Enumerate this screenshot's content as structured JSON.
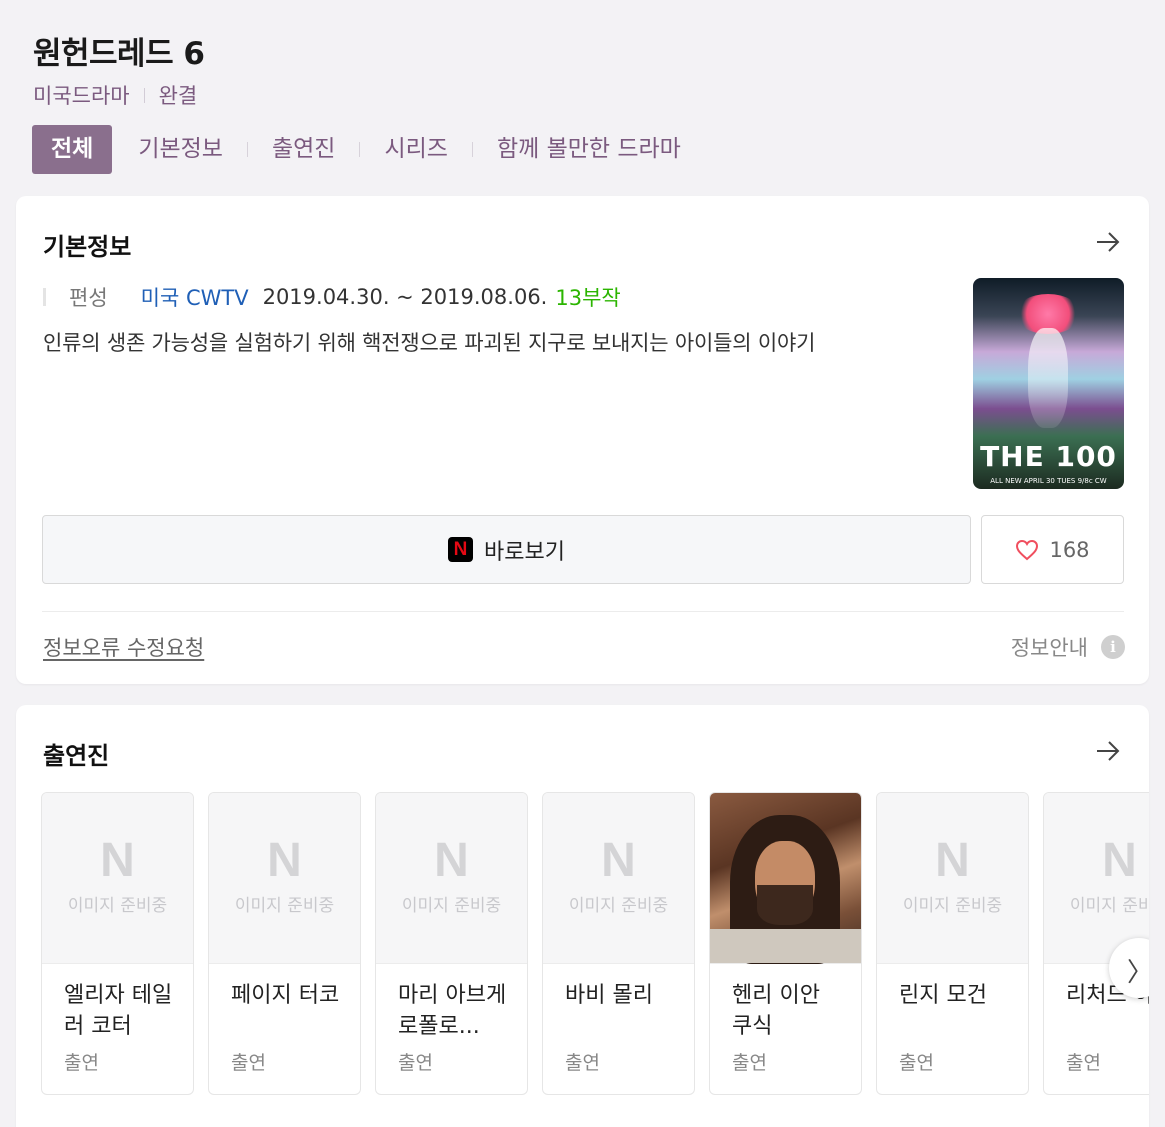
{
  "header": {
    "title": "원헌드레드 6",
    "genre": "미국드라마",
    "status": "완결"
  },
  "tabs": [
    {
      "label": "전체",
      "active": true
    },
    {
      "label": "기본정보"
    },
    {
      "label": "출연진"
    },
    {
      "label": "시리즈"
    },
    {
      "label": "함께 볼만한 드라마"
    }
  ],
  "basic": {
    "title": "기본정보",
    "label": "편성",
    "network": "미국 CWTV",
    "dates": "2019.04.30. ~ 2019.08.06.",
    "episodes": "13부작",
    "synopsis": "인류의 생존 가능성을 실험하기 위해 핵전쟁으로 파괴된 지구로 보내지는 아이들의 이야기",
    "poster_logo": "THE 100",
    "poster_foot": "ALL NEW APRIL 30 TUES 9/8c CW",
    "watch_label": "바로보기",
    "netflix_glyph": "N",
    "like_count": "168",
    "report_label": "정보오류 수정요청",
    "guide_label": "정보안내",
    "guide_icon_glyph": "i"
  },
  "cast": {
    "title": "출연진",
    "placeholder_logo": "N",
    "placeholder_text": "이미지 준비중",
    "items": [
      {
        "name": "엘리자 테일러 코터",
        "role": "출연"
      },
      {
        "name": "페이지 터코",
        "role": "출연"
      },
      {
        "name": "마리 아브게로폴로...",
        "role": "출연"
      },
      {
        "name": "바비 몰리",
        "role": "출연"
      },
      {
        "name": "헨리 이안 쿠식",
        "role": "출연"
      },
      {
        "name": "린지 모건",
        "role": "출연"
      },
      {
        "name": "리처드 하몬",
        "role": "출연"
      }
    ],
    "next_glyph": "〉"
  },
  "colors": {
    "accent": "#8a6f8d",
    "tab_text": "#7b5a7f",
    "network": "#1f5fb6",
    "episodes": "#2bb500",
    "heart": "#f04e5e"
  },
  "icons": {
    "arrow": "arrow-right-icon",
    "heart": "heart-icon",
    "netflix": "netflix-icon",
    "info": "info-icon"
  }
}
